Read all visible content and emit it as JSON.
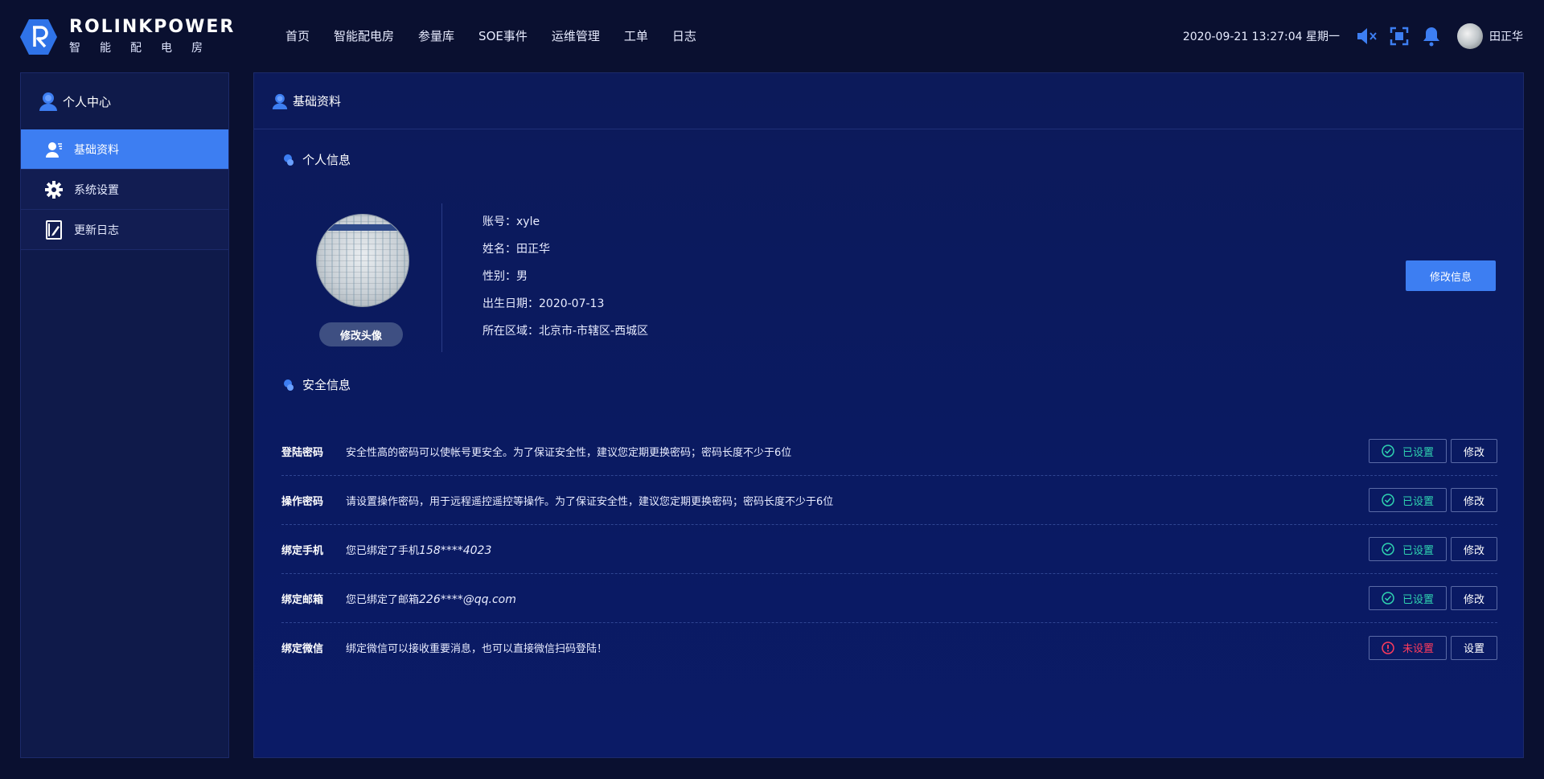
{
  "brand": {
    "name": "ROLINKPOWER",
    "subtitle": "智能配电房",
    "accent": "#3d7ef2"
  },
  "nav": {
    "items": [
      "首页",
      "智能配电房",
      "参量库",
      "SOE事件",
      "运维管理",
      "工单",
      "日志"
    ]
  },
  "header": {
    "datetime": "2020-09-21 13:27:04 星期一",
    "user_name": "田正华",
    "icons": [
      "mute-icon",
      "fullscreen-icon",
      "bell-icon"
    ]
  },
  "sidebar": {
    "title": "个人中心",
    "items": [
      {
        "label": "基础资料",
        "icon": "user-profile-icon",
        "active": true
      },
      {
        "label": "系统设置",
        "icon": "gear-icon",
        "active": false
      },
      {
        "label": "更新日志",
        "icon": "notebook-icon",
        "active": false
      }
    ]
  },
  "main": {
    "title": "基础资料",
    "personal": {
      "title": "个人信息",
      "change_avatar": "修改头像",
      "edit_button": "修改信息",
      "fields": [
        {
          "label": "账号：",
          "value": "xyle"
        },
        {
          "label": "姓名：",
          "value": "田正华"
        },
        {
          "label": "性别：",
          "value": "男"
        },
        {
          "label": "出生日期：",
          "value": "2020-07-13"
        },
        {
          "label": "所在区域：",
          "value": "北京市-市辖区-西城区"
        }
      ]
    },
    "security": {
      "title": "安全信息",
      "rows": [
        {
          "label": "登陆密码",
          "desc": "安全性高的密码可以使帐号更安全。为了保证安全性，建议您定期更换密码；密码长度不少于6位",
          "desc_extra": "",
          "status": "已设置",
          "status_ok": true,
          "action": "修改"
        },
        {
          "label": "操作密码",
          "desc": "请设置操作密码，用于远程遥控遥控等操作。为了保证安全性，建议您定期更换密码；密码长度不少于6位",
          "desc_extra": "",
          "status": "已设置",
          "status_ok": true,
          "action": "修改"
        },
        {
          "label": "绑定手机",
          "desc": "您已绑定了手机",
          "desc_extra": "158****4023",
          "status": "已设置",
          "status_ok": true,
          "action": "修改"
        },
        {
          "label": "绑定邮箱",
          "desc": "您已绑定了邮箱",
          "desc_extra": "226****@qq.com",
          "status": "已设置",
          "status_ok": true,
          "action": "修改"
        },
        {
          "label": "绑定微信",
          "desc": "绑定微信可以接收重要消息，也可以直接微信扫码登陆！",
          "desc_extra": "",
          "status": "未设置",
          "status_ok": false,
          "action": "设置"
        }
      ],
      "ok_color": "#2fd3b1",
      "warn_color": "#ff3b5c"
    }
  }
}
